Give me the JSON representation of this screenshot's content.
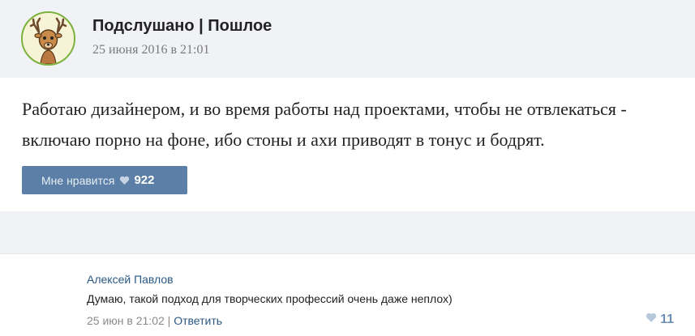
{
  "post": {
    "group_name": "Подслушано | Пошлое",
    "date": "25 июня 2016 в 21:01",
    "text": "Работаю дизайнером, и во время работы над проектами, чтобы не отвлекаться - включаю порно на фоне, ибо стоны и ахи приводят в тонус и бодрят.",
    "like_label": "Мне нравится",
    "like_count": "922",
    "avatar_icon": "deer-avatar-icon",
    "like_icon": "heart-icon"
  },
  "comment": {
    "author": "Алексей Павлов",
    "text": "Думаю, такой подход для творческих профессий очень даже неплох)",
    "date": "25 июн в 21:02",
    "separator": "|",
    "reply_label": "Ответить",
    "like_count": "11",
    "like_icon": "heart-icon"
  },
  "colors": {
    "header_bg": "#f0f2f5",
    "button_bg": "#5b7fa6",
    "link": "#2a5885"
  }
}
